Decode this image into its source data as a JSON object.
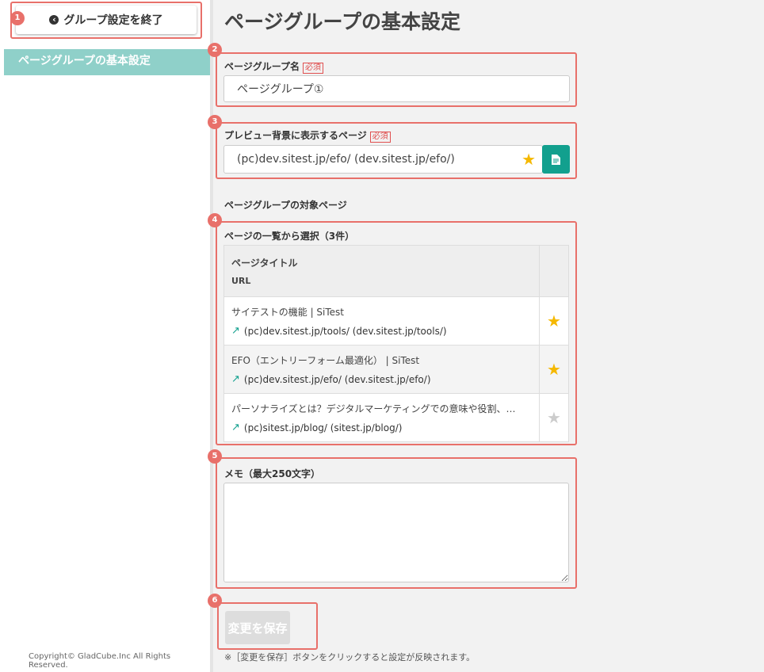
{
  "sidebar": {
    "exit_button": "グループ設定を終了",
    "items": [
      {
        "label": "ページグループの基本設定"
      }
    ],
    "copyright": "Copyright© GladCube.Inc All Rights Reserved."
  },
  "main": {
    "title": "ページグループの基本設定",
    "group_name": {
      "label": "ページグループ名",
      "required": "必須",
      "value": "ページグループ①"
    },
    "preview_page": {
      "label": "プレビュー背景に表示するページ",
      "required": "必須",
      "value": "(pc)dev.sitest.jp/efo/ (dev.sitest.jp/efo/)"
    },
    "target_section": "ページグループの対象ページ",
    "list_label": "ページの一覧から選択（3件）",
    "table": {
      "header_title": "ページタイトル",
      "header_url": "URL",
      "rows": [
        {
          "title": "サイテストの機能 | SiTest",
          "url": "(pc)dev.sitest.jp/tools/ (dev.sitest.jp/tools/)",
          "starred": true
        },
        {
          "title": "EFO（エントリーフォーム最適化） | SiTest",
          "url": "(pc)dev.sitest.jp/efo/ (dev.sitest.jp/efo/)",
          "starred": true
        },
        {
          "title": "パーソナライズとは？デジタルマーケティングでの意味や役割、…",
          "url": "(pc)sitest.jp/blog/ (sitest.jp/blog/)",
          "starred": false
        }
      ]
    },
    "memo_label": "メモ（最大250文字）",
    "memo_value": "",
    "save_button": "変更を保存",
    "note": "※［変更を保存］ボタンをクリックすると設定が反映されます。"
  },
  "annotations": [
    "1",
    "2",
    "3",
    "4",
    "5",
    "6"
  ],
  "colors": {
    "accent": "#12a08e",
    "sidebar_active": "#8fd0c9",
    "annotation": "#e8706a",
    "star": "#f5b800"
  }
}
